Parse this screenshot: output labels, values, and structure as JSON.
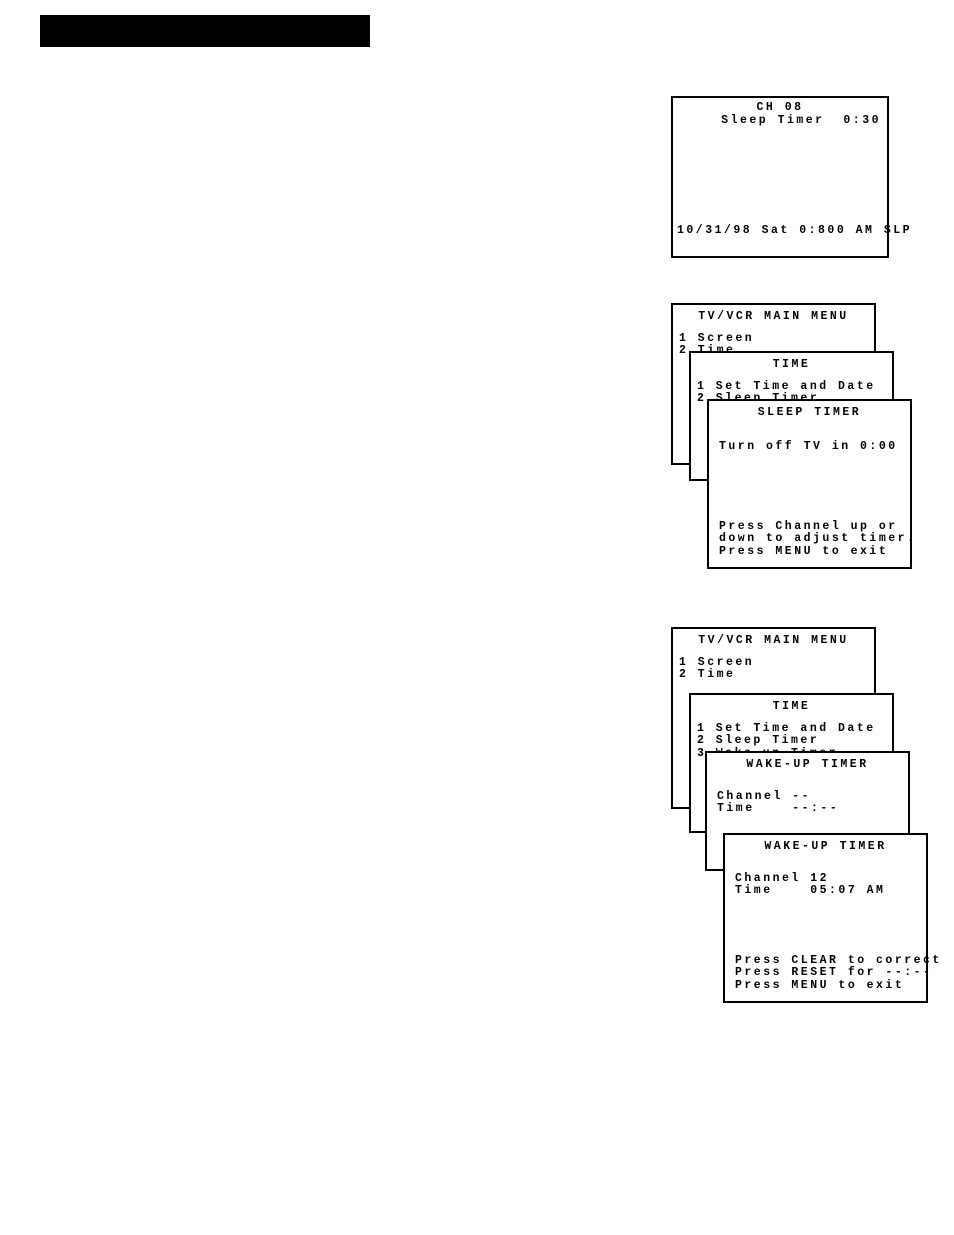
{
  "osd1": {
    "ch_line": "CH 08",
    "sleep_line": "Sleep Timer  0:30",
    "status_line": "10/31/98 Sat 0:800 AM SLP"
  },
  "group2": {
    "main": {
      "title": "TV/VCR MAIN MENU",
      "item1": "1 Screen",
      "item2": "2 Time"
    },
    "time": {
      "title": "TIME",
      "item1": "1 Set Time and Date",
      "item2": "2 Sleep Timer"
    },
    "sleep": {
      "title": "SLEEP TIMER",
      "body": "Turn off TV in 0:00",
      "hint1": "Press Channel up or",
      "hint2": "down to adjust timer.",
      "hint3": "Press MENU to exit"
    }
  },
  "group3": {
    "main": {
      "title": "TV/VCR MAIN MENU",
      "item1": "1 Screen",
      "item2": "2 Time"
    },
    "time": {
      "title": "TIME",
      "item1": "1 Set Time and Date",
      "item2": "2 Sleep Timer",
      "item3": "3 Wake-up Timer"
    },
    "wake1": {
      "title": "WAKE-UP TIMER",
      "ch": "Channel --",
      "tm": "Time    --:--"
    },
    "wake2": {
      "title": "WAKE-UP TIMER",
      "ch": "Channel 12",
      "tm": "Time    05:07 AM",
      "hint1": "Press CLEAR to correct",
      "hint2": "Press RESET for --:--",
      "hint3": "Press MENU to exit"
    }
  }
}
